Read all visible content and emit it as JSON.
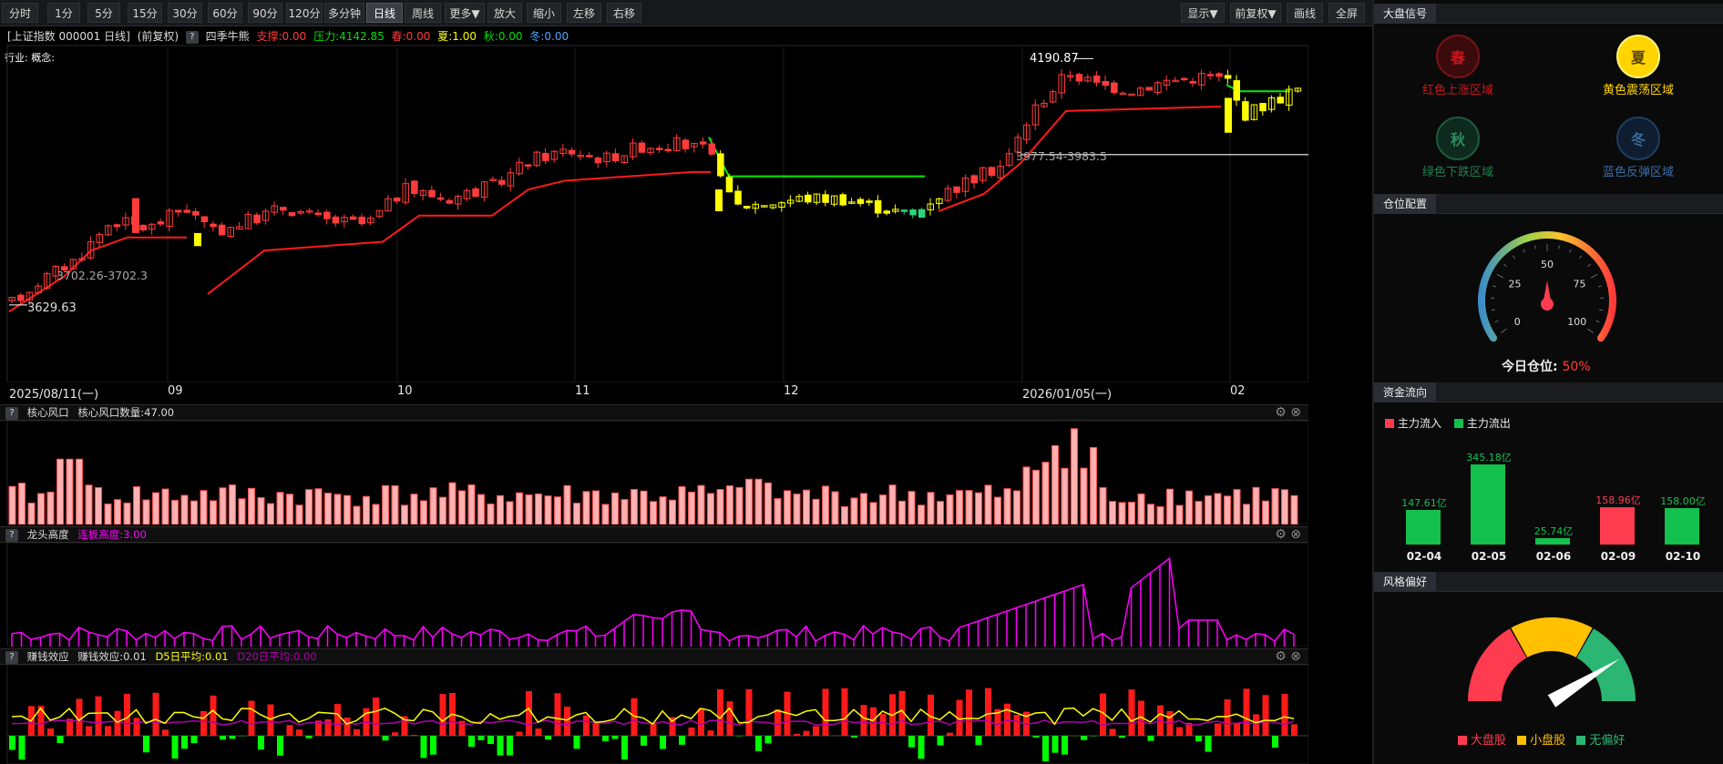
{
  "toolbar": {
    "left": [
      "分时",
      "1分",
      "5分",
      "15分",
      "30分",
      "60分",
      "90分",
      "120分",
      "多分钟",
      "日线",
      "周线",
      "更多▼",
      "放大",
      "缩小",
      "左移",
      "右移"
    ],
    "active": "日线",
    "right": [
      "显示▼",
      "前复权▼",
      "画线",
      "全屏"
    ]
  },
  "info": {
    "index_name": "[上证指数 000001 日线]",
    "adjust": "(前复权)",
    "indicator": "四季牛熊",
    "support": "支撑:0.00",
    "pressure": "压力:4142.85",
    "spring": "春:0.00",
    "summer": "夏:1.00",
    "autumn": "秋:0.00",
    "winter": "冬:0.00",
    "industry": "行业: 概念:"
  },
  "main_chart": {
    "y_ticks": [
      "4200.0",
      "4050.0",
      "3950.0",
      "3850.0",
      "3750.0",
      "3650.0",
      "3550.0"
    ],
    "annotations": {
      "high": "4190.87",
      "low": "3629.63",
      "range1": "3702.26-3702.3",
      "range2": "3977.54-3983.5"
    },
    "x_labels": [
      "2025/08/11(一)",
      "09",
      "10",
      "11",
      "12",
      "2026/01/05(一)",
      "02"
    ]
  },
  "panels": {
    "core": {
      "title": "核心风口",
      "value": "核心风口数量:47.00",
      "y_ticks": [
        "109.00",
        "72.67",
        "36.33"
      ]
    },
    "dragon": {
      "title": "龙头高度",
      "value": "连板高度:3.00",
      "y_ticks": [
        "18.00",
        "12.67",
        "7.33"
      ]
    },
    "money": {
      "title": "赚钱效应",
      "value": "赚钱效应:0.01",
      "d5": "D5日平均:0.01",
      "d20": "D20日平均:0.00",
      "y_ticks": [
        "0.04",
        "0.02",
        "-0.00"
      ]
    }
  },
  "right_panel": {
    "signal": {
      "header": "大盘信号",
      "items": [
        {
          "glyph": "春",
          "label": "红色上涨区域",
          "color": "#c8181e"
        },
        {
          "glyph": "夏",
          "label": "黄色震荡区域",
          "color": "#ffd400"
        },
        {
          "glyph": "秋",
          "label": "绿色下跌区域",
          "color": "#1e6e46"
        },
        {
          "glyph": "冬",
          "label": "蓝色反弹区域",
          "color": "#2a5a90"
        }
      ]
    },
    "position": {
      "header": "仓位配置",
      "gauge_labels": [
        "0",
        "25",
        "50",
        "75",
        "100"
      ],
      "today_label": "今日仓位:",
      "today_value": "50%",
      "value": 50
    },
    "flow": {
      "header": "资金流向",
      "legend_in": "主力流入",
      "legend_out": "主力流出",
      "bars": [
        {
          "date": "02-04",
          "value": "147.61亿",
          "amount": 147.61,
          "dir": "out"
        },
        {
          "date": "02-05",
          "value": "345.18亿",
          "amount": 345.18,
          "dir": "out"
        },
        {
          "date": "02-06",
          "value": "25.74亿",
          "amount": 25.74,
          "dir": "out"
        },
        {
          "date": "02-09",
          "value": "158.96亿",
          "amount": 158.96,
          "dir": "in"
        },
        {
          "date": "02-10",
          "value": "158.00亿",
          "amount": 158.0,
          "dir": "out"
        }
      ]
    },
    "style": {
      "header": "风格偏好",
      "legend": [
        "大盘股",
        "小盘股",
        "无偏好"
      ],
      "colors": [
        "#ff3b4f",
        "#ffc000",
        "#2bb673"
      ]
    }
  },
  "colors": {
    "up": "#ff3b3b",
    "down_yellow": "#ffff00",
    "green": "#00ff00",
    "magenta": "#ff00ff"
  }
}
